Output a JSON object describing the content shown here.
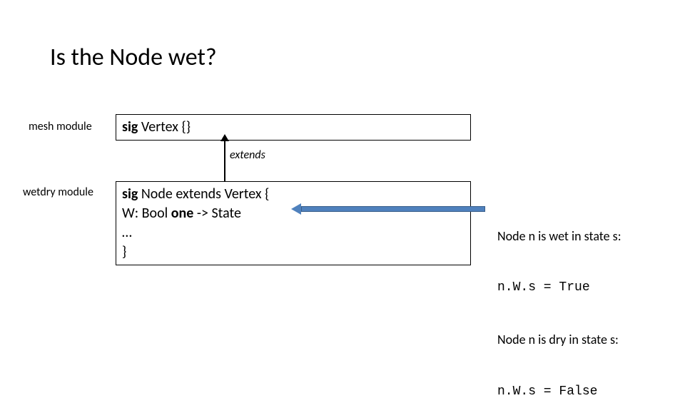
{
  "title": "Is the Node wet?",
  "labels": {
    "mesh_module": "mesh module",
    "wetdry_module": "wetdry module",
    "extends": "extends"
  },
  "boxes": {
    "vertex": {
      "kw": "sig",
      "rest": " Vertex {}"
    },
    "node": {
      "line1_kw": "sig",
      "line1_rest": " Node extends Vertex {",
      "line2_pre": "      W: Bool ",
      "line2_kw": "one",
      "line2_post": " -> State",
      "line3": "       …",
      "line4": "}"
    }
  },
  "info": {
    "l1": "Node n is wet in state s:",
    "l2": "n.W.s = True",
    "l3": "Node n is dry in state s:",
    "l4": "n.W.s = False"
  }
}
